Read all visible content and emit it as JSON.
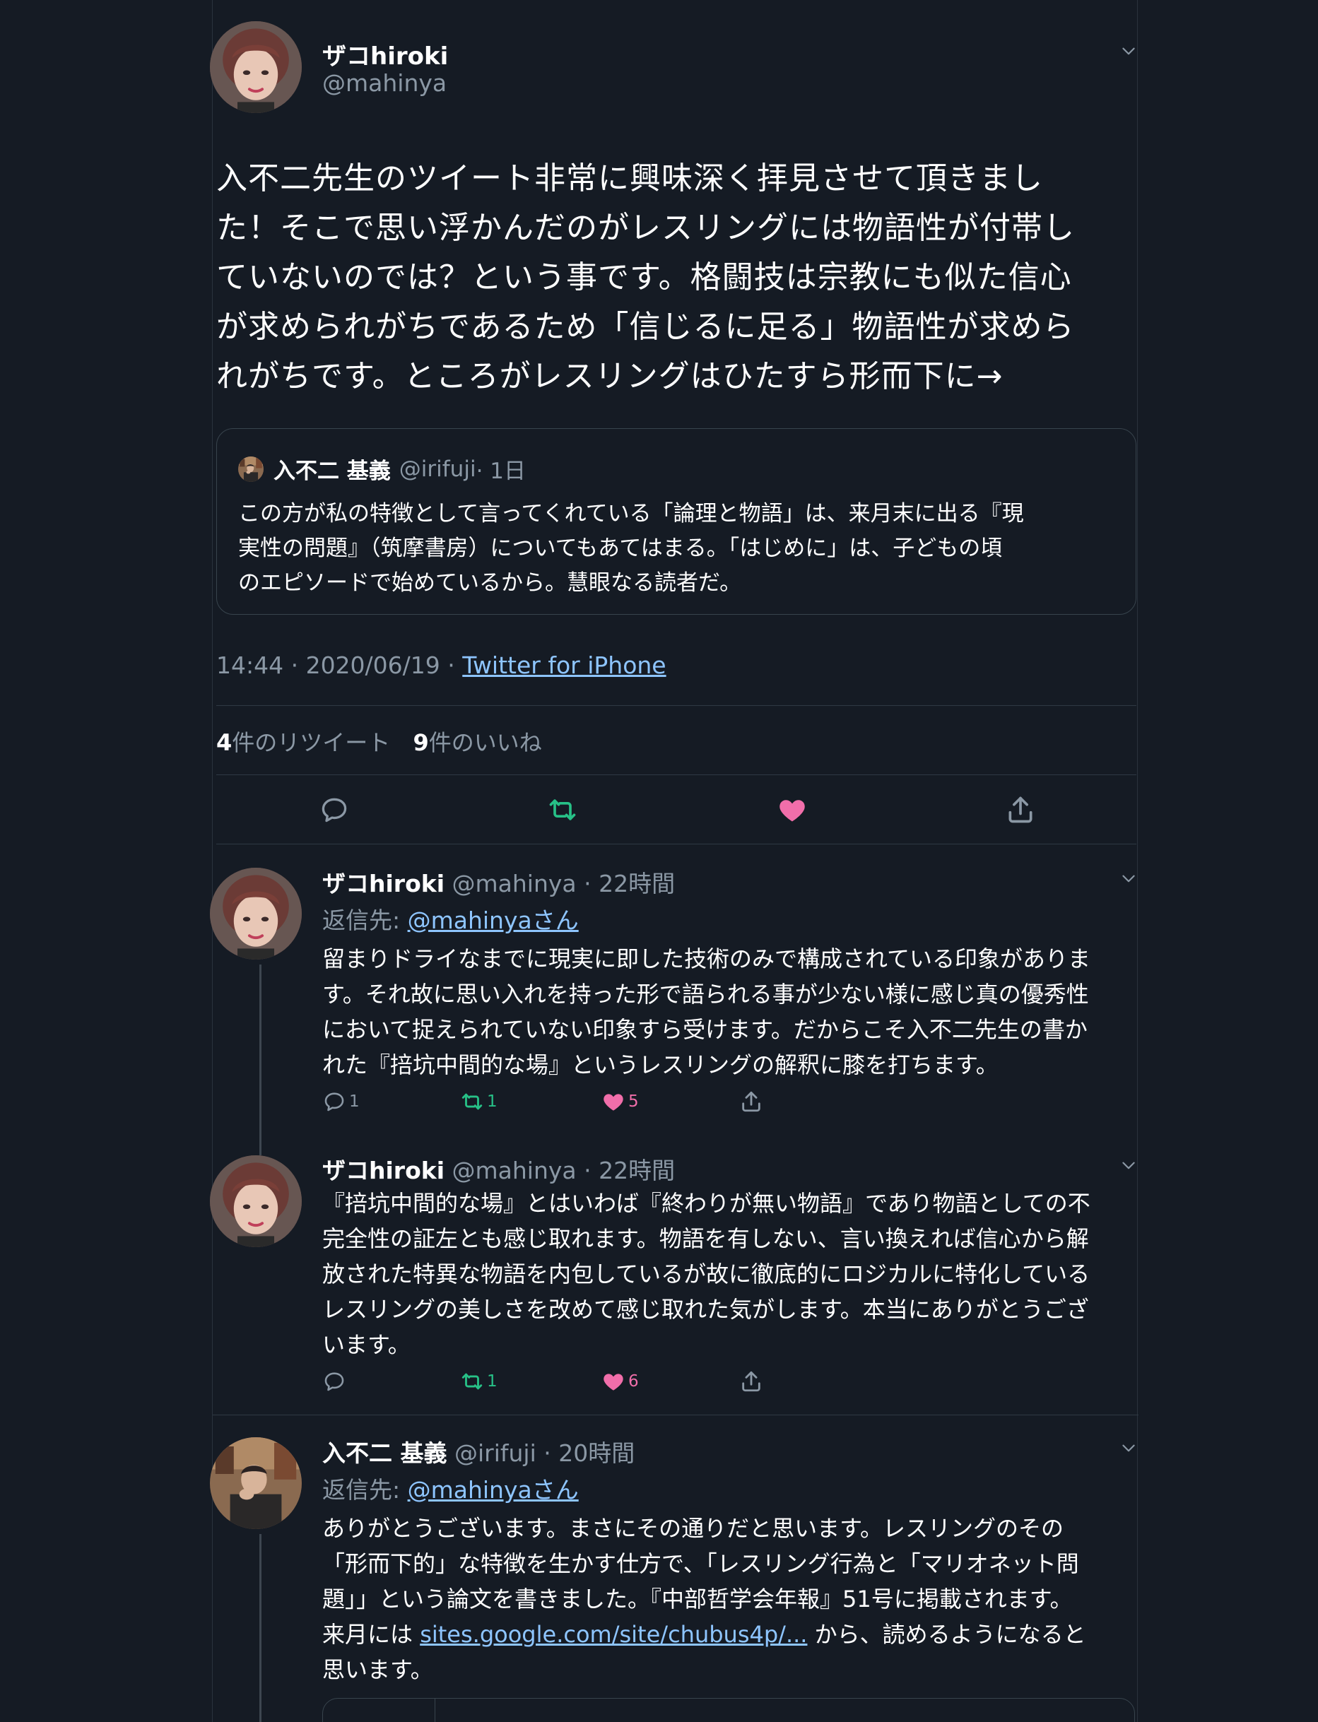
{
  "main_tweet": {
    "name": "ザコhiroki",
    "handle": "@mahinya",
    "text": "入不二先生のツイート非常に興味深く拝見させて頂きまし\nた！そこで思い浮かんだのがレスリングには物語性が付帯し\nていないのでは？という事です。格闘技は宗教にも似た信心\nが求められがちであるため「信じるに足る」物語性が求めら\nれがちです。ところがレスリングはひたすら形而下に→",
    "quote": {
      "name": "入不二 基義",
      "handle": "@irifuji",
      "time": "· 1日",
      "text": "この方が私の特徴として言ってくれている「論理と物語」は、来月末に出る『現\n実性の問題』（筑摩書房）についてもあてはまる。「はじめに」は、子どもの頃\nのエピソードで始めているから。慧眼なる読者だ。"
    },
    "timestamp": "14:44 · 2020/06/19 · ",
    "source": "Twitter for iPhone",
    "retweets_count": "4",
    "retweets_label": "件のリツイート",
    "likes_count": "9",
    "likes_label": "件のいいね"
  },
  "replies": [
    {
      "name": "ザコhiroki",
      "handle": "@mahinya",
      "time": "· 22時間",
      "reply_to_label": "返信先: ",
      "reply_to_user": "@mahinyaさん",
      "text": "留まりドライなまでに現実に即した技術のみで構成されている印象がありま\nす。それ故に思い入れを持った形で語られる事が少ない様に感じ真の優秀性\nにおいて捉えられていない印象すら受けます。だからこそ入不二先生の書か\nれた『掊坑中間的な場』というレスリングの解釈に膝を打ちます。",
      "replies": "1",
      "retweets": "1",
      "likes": "5"
    },
    {
      "name": "ザコhiroki",
      "handle": "@mahinya",
      "time": "· 22時間",
      "text": "『掊坑中間的な場』とはいわば『終わりが無い物語』であり物語としての不\n完全性の証左とも感じ取れます。物語を有しない、言い換えれば信心から解\n放された特異な物語を内包しているが故に徹底的にロジカルに特化している\nレスリングの美しさを改めて感じ取れた気がします。本当にありがとうござ\nいます。",
      "retweets": "1",
      "likes": "6"
    },
    {
      "name": "入不二 基義",
      "handle": "@irifuji",
      "time": "· 20時間",
      "reply_to_label": "返信先: ",
      "reply_to_user": "@mahinyaさん",
      "text_before_link": "ありがとうございます。まさにその通りだと思います。レスリングのその\n「形而下的」な特徴を生かす仕方で、「レスリング行為と「マリオネット問\n題」」という論文を書きました。『中部哲学会年報』51号に掲載されます。\n来月には ",
      "link": "sites.google.com/site/chubus4p/...",
      "text_after_link": " から、読めるようになると\n思います。"
    }
  ],
  "icons": [
    "chevron-down-icon",
    "reply-icon",
    "retweet-icon",
    "heart-icon",
    "share-icon"
  ],
  "colors": {
    "background": "#151b24",
    "link": "#8ec5ff",
    "retweet": "#27c187",
    "like": "#f16eaa",
    "muted": "#8b98a5"
  }
}
